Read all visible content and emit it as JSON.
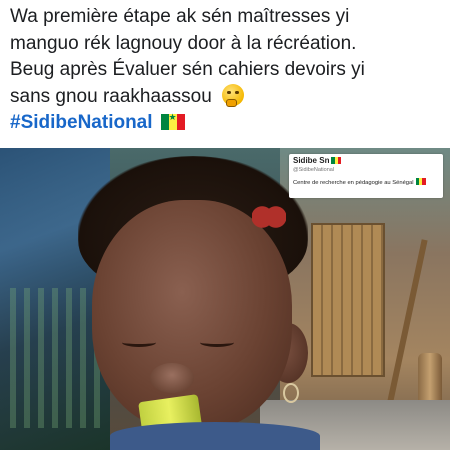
{
  "post": {
    "lines": [
      "Wa première étape ak sén maîtresses yi",
      "manguo rék lagnouy door à la récréation.",
      "Beug après Évaluer sén cahiers devoirs yi",
      "sans gnou raakhaassou"
    ],
    "emoji": "thinking-face-emoji",
    "hashtag": "#SidibeNational",
    "flag": "senegal-flag"
  },
  "photo": {
    "description_icon": "painting-child-eating-sugarcane",
    "card": {
      "name": "Sidibe Sn",
      "handle": "@SidibeNational",
      "description": "Centre de recherche en pédagogie au Sénégal"
    }
  },
  "colors": {
    "text": "#1c1e21",
    "hashtag": "#1867c9",
    "flag_green": "#00853f",
    "flag_yellow": "#fdef42",
    "flag_red": "#e31b23"
  }
}
